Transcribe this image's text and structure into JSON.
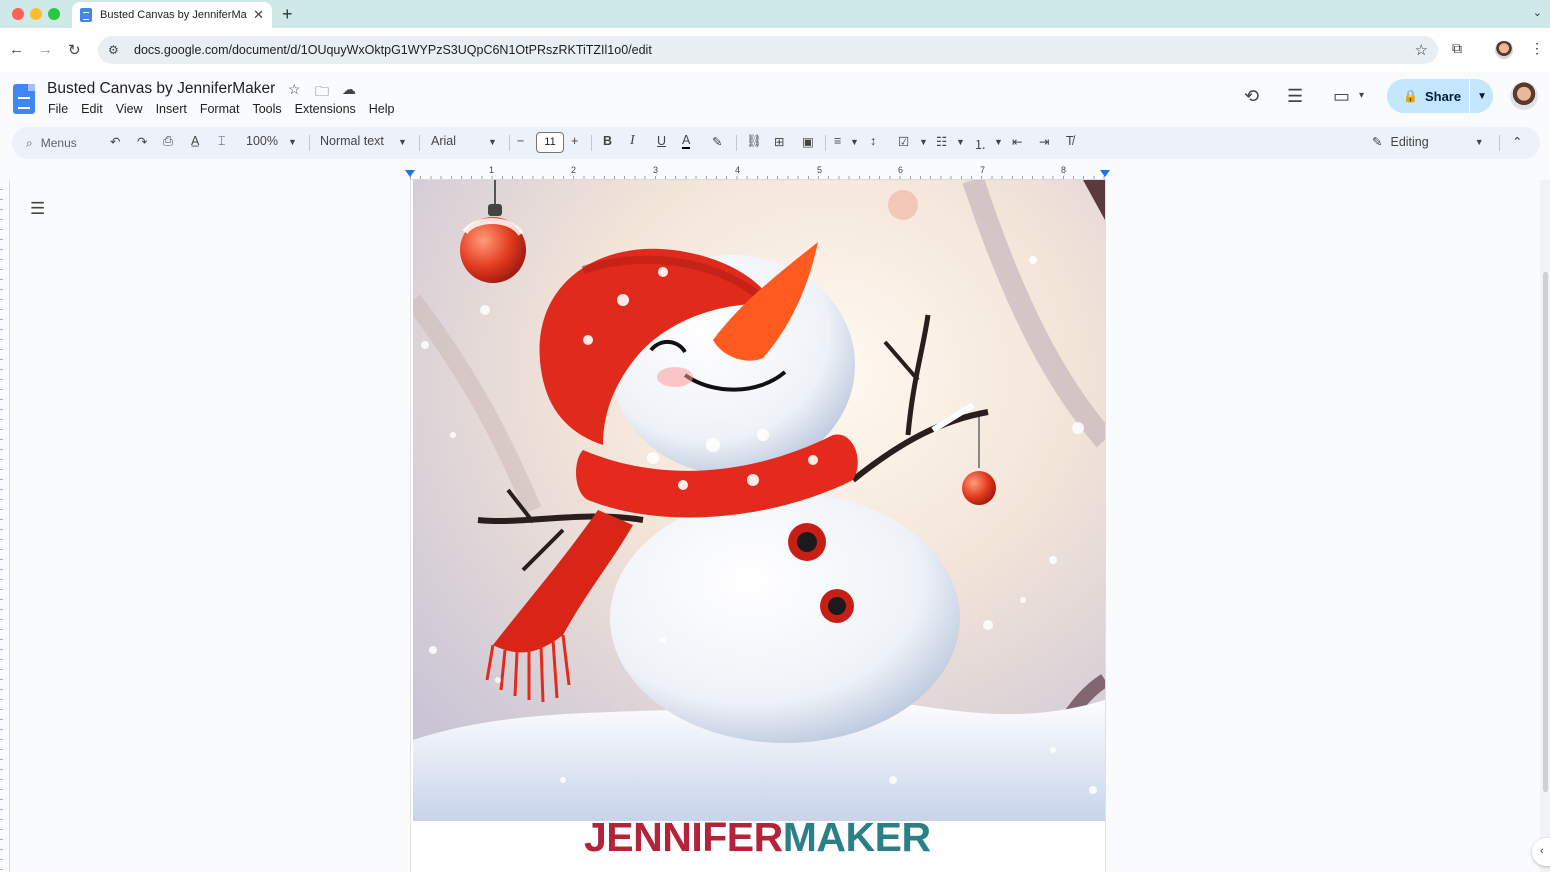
{
  "browser": {
    "tab_title": "Busted Canvas by JenniferMa",
    "url": "docs.google.com/document/d/1OUquyWxOktpG1WYPzS3UQpC6N1OtPRszRKTiTZIl1o0/edit"
  },
  "doc": {
    "title": "Busted Canvas by JenniferMaker",
    "menus": [
      "File",
      "Edit",
      "View",
      "Insert",
      "Format",
      "Tools",
      "Extensions",
      "Help"
    ],
    "share_label": "Share"
  },
  "toolbar": {
    "search_placeholder": "Menus",
    "zoom": "100%",
    "style": "Normal text",
    "font": "Arial",
    "font_size": "11",
    "mode": "Editing"
  },
  "ruler": {
    "numbers": [
      "1",
      "2",
      "3",
      "4",
      "5",
      "6",
      "7",
      "8"
    ]
  },
  "content": {
    "brand_part1": "JENNIFER",
    "brand_part2": "MAKER"
  },
  "colors": {
    "brand_red": "#b5233a",
    "brand_teal": "#2b7f86",
    "share_bg": "#c2e7ff",
    "toolbar_bg": "#edf2fa"
  }
}
